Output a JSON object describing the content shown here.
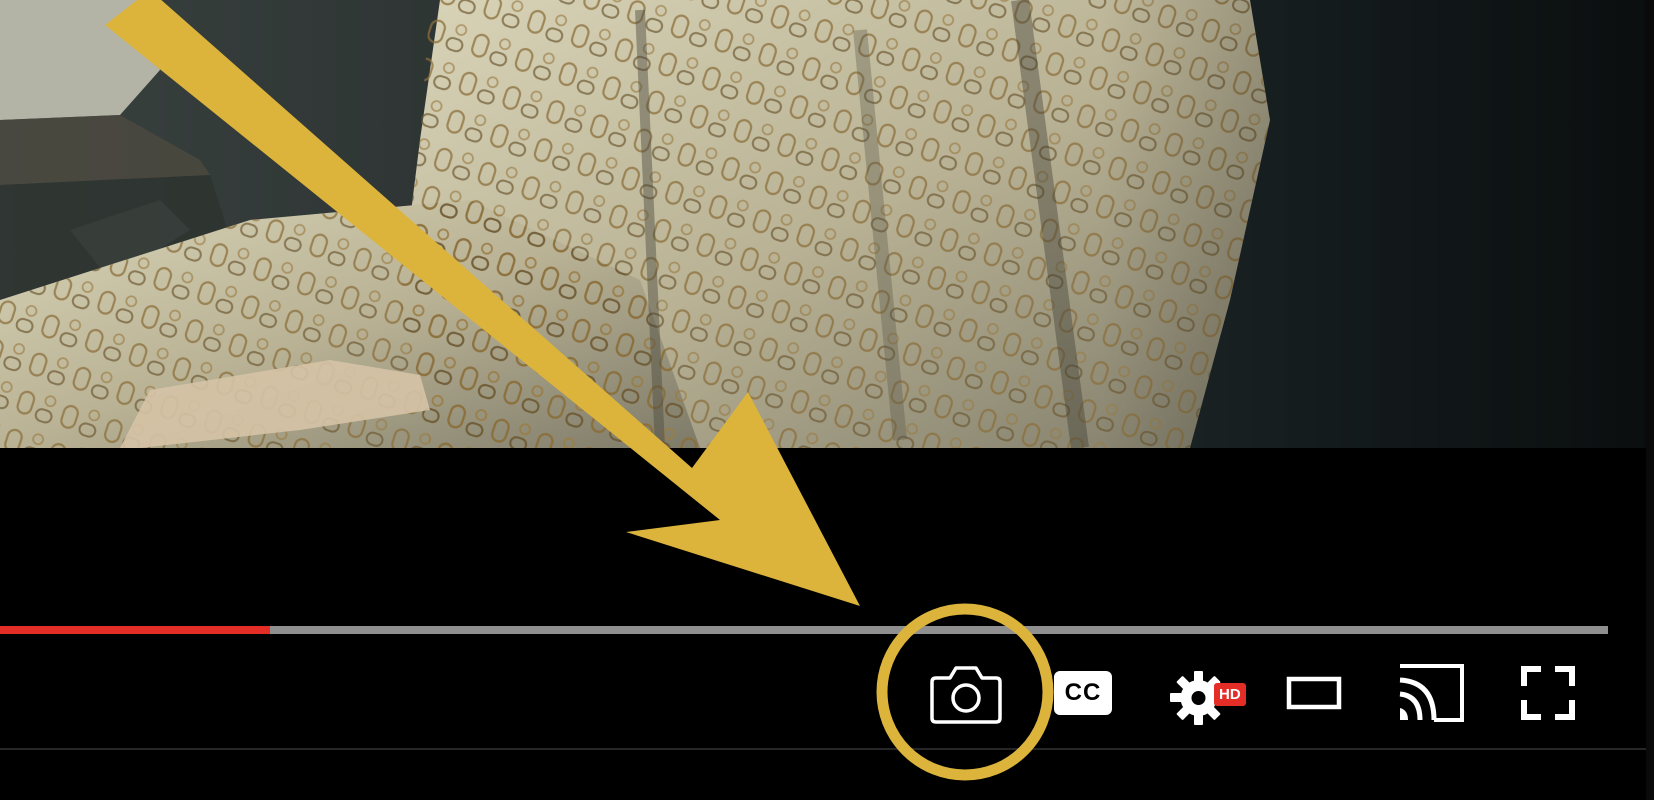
{
  "player": {
    "progress_played_fraction": 0.168,
    "colors": {
      "progress_played": "#e52d27",
      "progress_track": "#8f8f8f",
      "annotation": "#dcb43c",
      "background": "#000000"
    },
    "controls": [
      {
        "name": "screenshot-camera-button",
        "icon": "camera-icon"
      },
      {
        "name": "subtitles-cc-button",
        "icon": "cc-icon",
        "label": "CC"
      },
      {
        "name": "settings-button",
        "icon": "gear-icon",
        "badge": "HD"
      },
      {
        "name": "theater-mode-button",
        "icon": "theater-mode-icon"
      },
      {
        "name": "cast-button",
        "icon": "cast-icon"
      },
      {
        "name": "fullscreen-button",
        "icon": "fullscreen-icon"
      }
    ]
  },
  "annotation": {
    "type": "arrow-and-circle",
    "target": "screenshot-camera-button",
    "color": "#dcb43c"
  }
}
